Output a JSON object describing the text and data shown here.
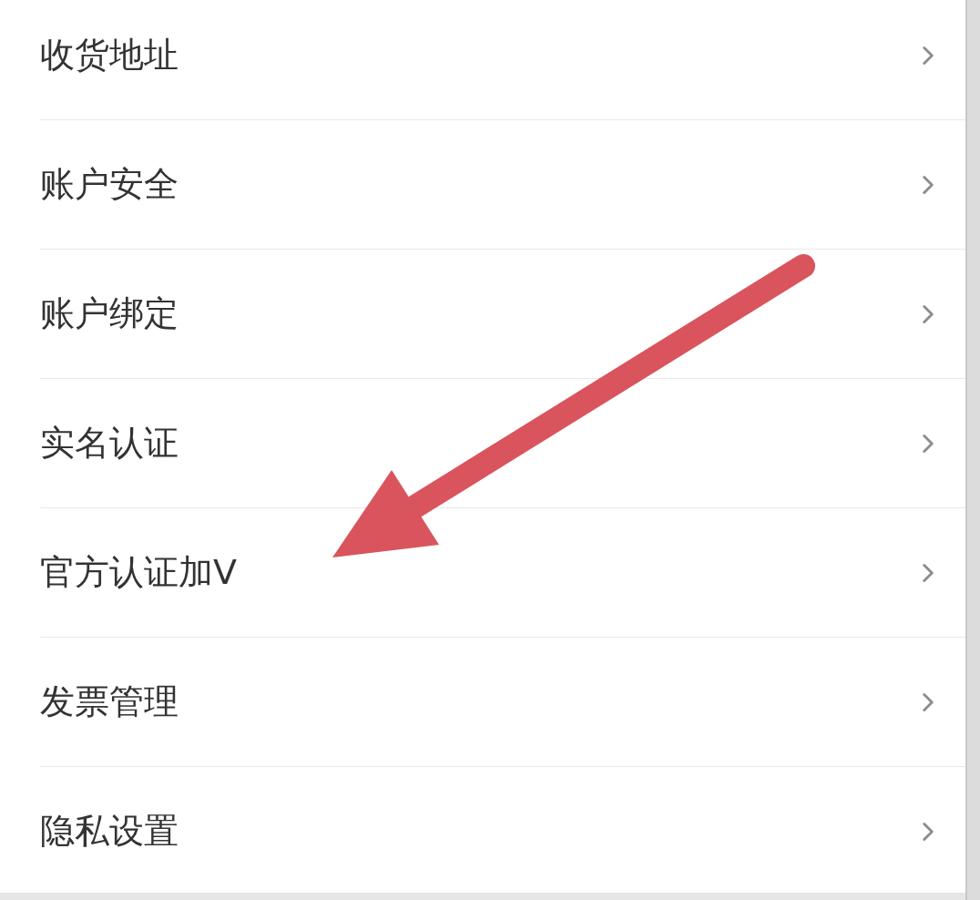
{
  "menu": {
    "items": [
      {
        "label": "收货地址"
      },
      {
        "label": "账户安全"
      },
      {
        "label": "账户绑定"
      },
      {
        "label": "实名认证"
      },
      {
        "label": "官方认证加V"
      },
      {
        "label": "发票管理"
      },
      {
        "label": "隐私设置"
      }
    ]
  }
}
